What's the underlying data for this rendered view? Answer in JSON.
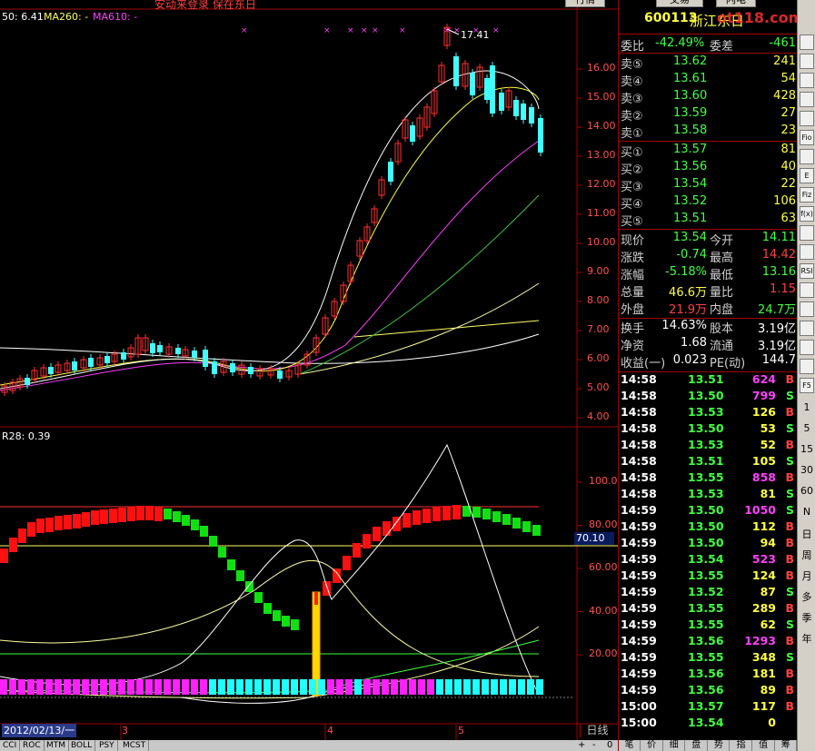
{
  "header": {
    "top_text": "安动来登录  保在东日",
    "buttons": [
      "行情",
      "交易",
      "闪电"
    ],
    "ma_labels": [
      {
        "text": "50: 6.41",
        "color": "#ffffff"
      },
      {
        "text": "MA260: -",
        "color": "#ffff60"
      },
      {
        "text": "MA610: -",
        "color": "#ff40ff"
      }
    ],
    "price_high_label": "17.41",
    "indicator_label": "R28: 0.39",
    "highlight_value": "70.10"
  },
  "price_axis": [
    "16.00",
    "15.00",
    "14.00",
    "13.00",
    "12.00",
    "11.00",
    "10.00",
    "9.00",
    "8.00",
    "7.00",
    "6.00",
    "5.00",
    "4.00"
  ],
  "indicator_axis": [
    "100.0",
    "80.00",
    "60.00",
    "40.00",
    "20.00"
  ],
  "date_axis": {
    "first": "2012/02/13/一",
    "months": [
      "3",
      "4",
      "5"
    ],
    "period": "日线"
  },
  "bottom_tabs": [
    "CCI",
    "ROC",
    "MTM",
    "BOLL",
    "PSY",
    "MCST"
  ],
  "bottom_nav": [
    "+",
    "-",
    "0"
  ],
  "quote": {
    "code": "600113",
    "name": "浙江东日",
    "watermark": "ot118.com",
    "weibi_label": "委比",
    "weibi": "-42.49%",
    "weicha_label": "委差",
    "weicha": "-461",
    "sells": [
      {
        "label": "卖⑤",
        "price": "13.62",
        "vol": "241"
      },
      {
        "label": "卖④",
        "price": "13.61",
        "vol": "54"
      },
      {
        "label": "卖③",
        "price": "13.60",
        "vol": "428"
      },
      {
        "label": "卖②",
        "price": "13.59",
        "vol": "27"
      },
      {
        "label": "卖①",
        "price": "13.58",
        "vol": "23"
      }
    ],
    "buys": [
      {
        "label": "买①",
        "price": "13.57",
        "vol": "81"
      },
      {
        "label": "买②",
        "price": "13.56",
        "vol": "40"
      },
      {
        "label": "买③",
        "price": "13.54",
        "vol": "22"
      },
      {
        "label": "买④",
        "price": "13.52",
        "vol": "106"
      },
      {
        "label": "买⑤",
        "price": "13.51",
        "vol": "63"
      }
    ],
    "stats": [
      {
        "l1": "现价",
        "v1": "13.54",
        "c1": "#40ff40",
        "l2": "今开",
        "v2": "14.11",
        "c2": "#40ff40"
      },
      {
        "l1": "涨跌",
        "v1": "-0.74",
        "c1": "#40ff40",
        "l2": "最高",
        "v2": "14.42",
        "c2": "#ff4040"
      },
      {
        "l1": "涨幅",
        "v1": "-5.18%",
        "c1": "#40ff40",
        "l2": "最低",
        "v2": "13.16",
        "c2": "#40ff40"
      },
      {
        "l1": "总量",
        "v1": "46.6万",
        "c1": "#ffff40",
        "l2": "量比",
        "v2": "1.15",
        "c2": "#ff4040"
      },
      {
        "l1": "外盘",
        "v1": "21.9万",
        "c1": "#ff4040",
        "l2": "内盘",
        "v2": "24.7万",
        "c2": "#40ff40"
      }
    ],
    "stats2": [
      {
        "l1": "换手",
        "v1": "14.63%",
        "l2": "股本",
        "v2": "3.19亿"
      },
      {
        "l1": "净资",
        "v1": "1.68",
        "l2": "流通",
        "v2": "3.19亿"
      },
      {
        "l1": "收益(一)",
        "v1": "0.023",
        "l2": "PE(动)",
        "v2": "144.7"
      }
    ],
    "ticks": [
      {
        "t": "14:58",
        "p": "13.51",
        "pc": "#40ff40",
        "v": "624",
        "vc": "#ff40ff",
        "bs": "B"
      },
      {
        "t": "14:58",
        "p": "13.50",
        "pc": "#40ff40",
        "v": "799",
        "vc": "#ff40ff",
        "bs": "S"
      },
      {
        "t": "14:58",
        "p": "13.53",
        "pc": "#40ff40",
        "v": "126",
        "vc": "#ffff40",
        "bs": "B"
      },
      {
        "t": "14:58",
        "p": "13.50",
        "pc": "#40ff40",
        "v": "53",
        "vc": "#ffff40",
        "bs": "S"
      },
      {
        "t": "14:58",
        "p": "13.53",
        "pc": "#40ff40",
        "v": "52",
        "vc": "#ffff40",
        "bs": "B"
      },
      {
        "t": "14:58",
        "p": "13.51",
        "pc": "#40ff40",
        "v": "105",
        "vc": "#ffff40",
        "bs": "S"
      },
      {
        "t": "14:58",
        "p": "13.55",
        "pc": "#40ff40",
        "v": "858",
        "vc": "#ff40ff",
        "bs": "B"
      },
      {
        "t": "14:58",
        "p": "13.53",
        "pc": "#40ff40",
        "v": "81",
        "vc": "#ffff40",
        "bs": "S"
      },
      {
        "t": "14:59",
        "p": "13.50",
        "pc": "#40ff40",
        "v": "1050",
        "vc": "#ff40ff",
        "bs": "S"
      },
      {
        "t": "14:59",
        "p": "13.50",
        "pc": "#40ff40",
        "v": "112",
        "vc": "#ffff40",
        "bs": "B"
      },
      {
        "t": "14:59",
        "p": "13.50",
        "pc": "#40ff40",
        "v": "94",
        "vc": "#ffff40",
        "bs": "B"
      },
      {
        "t": "14:59",
        "p": "13.54",
        "pc": "#40ff40",
        "v": "523",
        "vc": "#ff40ff",
        "bs": "B"
      },
      {
        "t": "14:59",
        "p": "13.55",
        "pc": "#40ff40",
        "v": "124",
        "vc": "#ffff40",
        "bs": "B"
      },
      {
        "t": "14:59",
        "p": "13.52",
        "pc": "#40ff40",
        "v": "87",
        "vc": "#ffff40",
        "bs": "S"
      },
      {
        "t": "14:59",
        "p": "13.55",
        "pc": "#40ff40",
        "v": "289",
        "vc": "#ffff40",
        "bs": "B"
      },
      {
        "t": "14:59",
        "p": "13.55",
        "pc": "#40ff40",
        "v": "62",
        "vc": "#ffff40",
        "bs": "S"
      },
      {
        "t": "14:59",
        "p": "13.56",
        "pc": "#40ff40",
        "v": "1293",
        "vc": "#ff40ff",
        "bs": "B"
      },
      {
        "t": "14:59",
        "p": "13.55",
        "pc": "#40ff40",
        "v": "348",
        "vc": "#ffff40",
        "bs": "S"
      },
      {
        "t": "14:59",
        "p": "13.56",
        "pc": "#40ff40",
        "v": "181",
        "vc": "#ffff40",
        "bs": "B"
      },
      {
        "t": "14:59",
        "p": "13.56",
        "pc": "#40ff40",
        "v": "89",
        "vc": "#ffff40",
        "bs": "B"
      },
      {
        "t": "15:00",
        "p": "13.57",
        "pc": "#40ff40",
        "v": "117",
        "vc": "#ffff40",
        "bs": "B"
      },
      {
        "t": "15:00",
        "p": "13.54",
        "pc": "#40ff40",
        "v": "0",
        "vc": "#ffff40",
        "bs": ""
      }
    ],
    "tabs": [
      "笔",
      "价",
      "细",
      "盘",
      "势",
      "指",
      "值",
      "筹"
    ]
  },
  "right_toolbar": {
    "icons": [
      "doc-icon",
      "grid-icon",
      "trend-icon",
      "bars-icon",
      "info-icon",
      "table-icon",
      "fin-icon",
      "text-icon",
      "fiz-icon",
      "fx-icon",
      "page-icon",
      "list-icon",
      "rsi-icon",
      "arrow-icon",
      "play-icon",
      "pencil-icon",
      "dot-icon",
      "up-icon",
      "f5-icon"
    ],
    "icon_labels": [
      "",
      "",
      "",
      "",
      "",
      "Fio",
      "",
      "E",
      "Fiz",
      "f(x)",
      "",
      "",
      "RSI",
      "",
      "",
      "",
      "",
      "",
      "F5"
    ],
    "periods": [
      "1",
      "5",
      "15",
      "30",
      "60",
      "N",
      "日",
      "周",
      "月",
      "多",
      "季",
      "年"
    ]
  },
  "colors": {
    "up": "#ff3030",
    "down": "#40ffff",
    "grid": "#a00000"
  }
}
